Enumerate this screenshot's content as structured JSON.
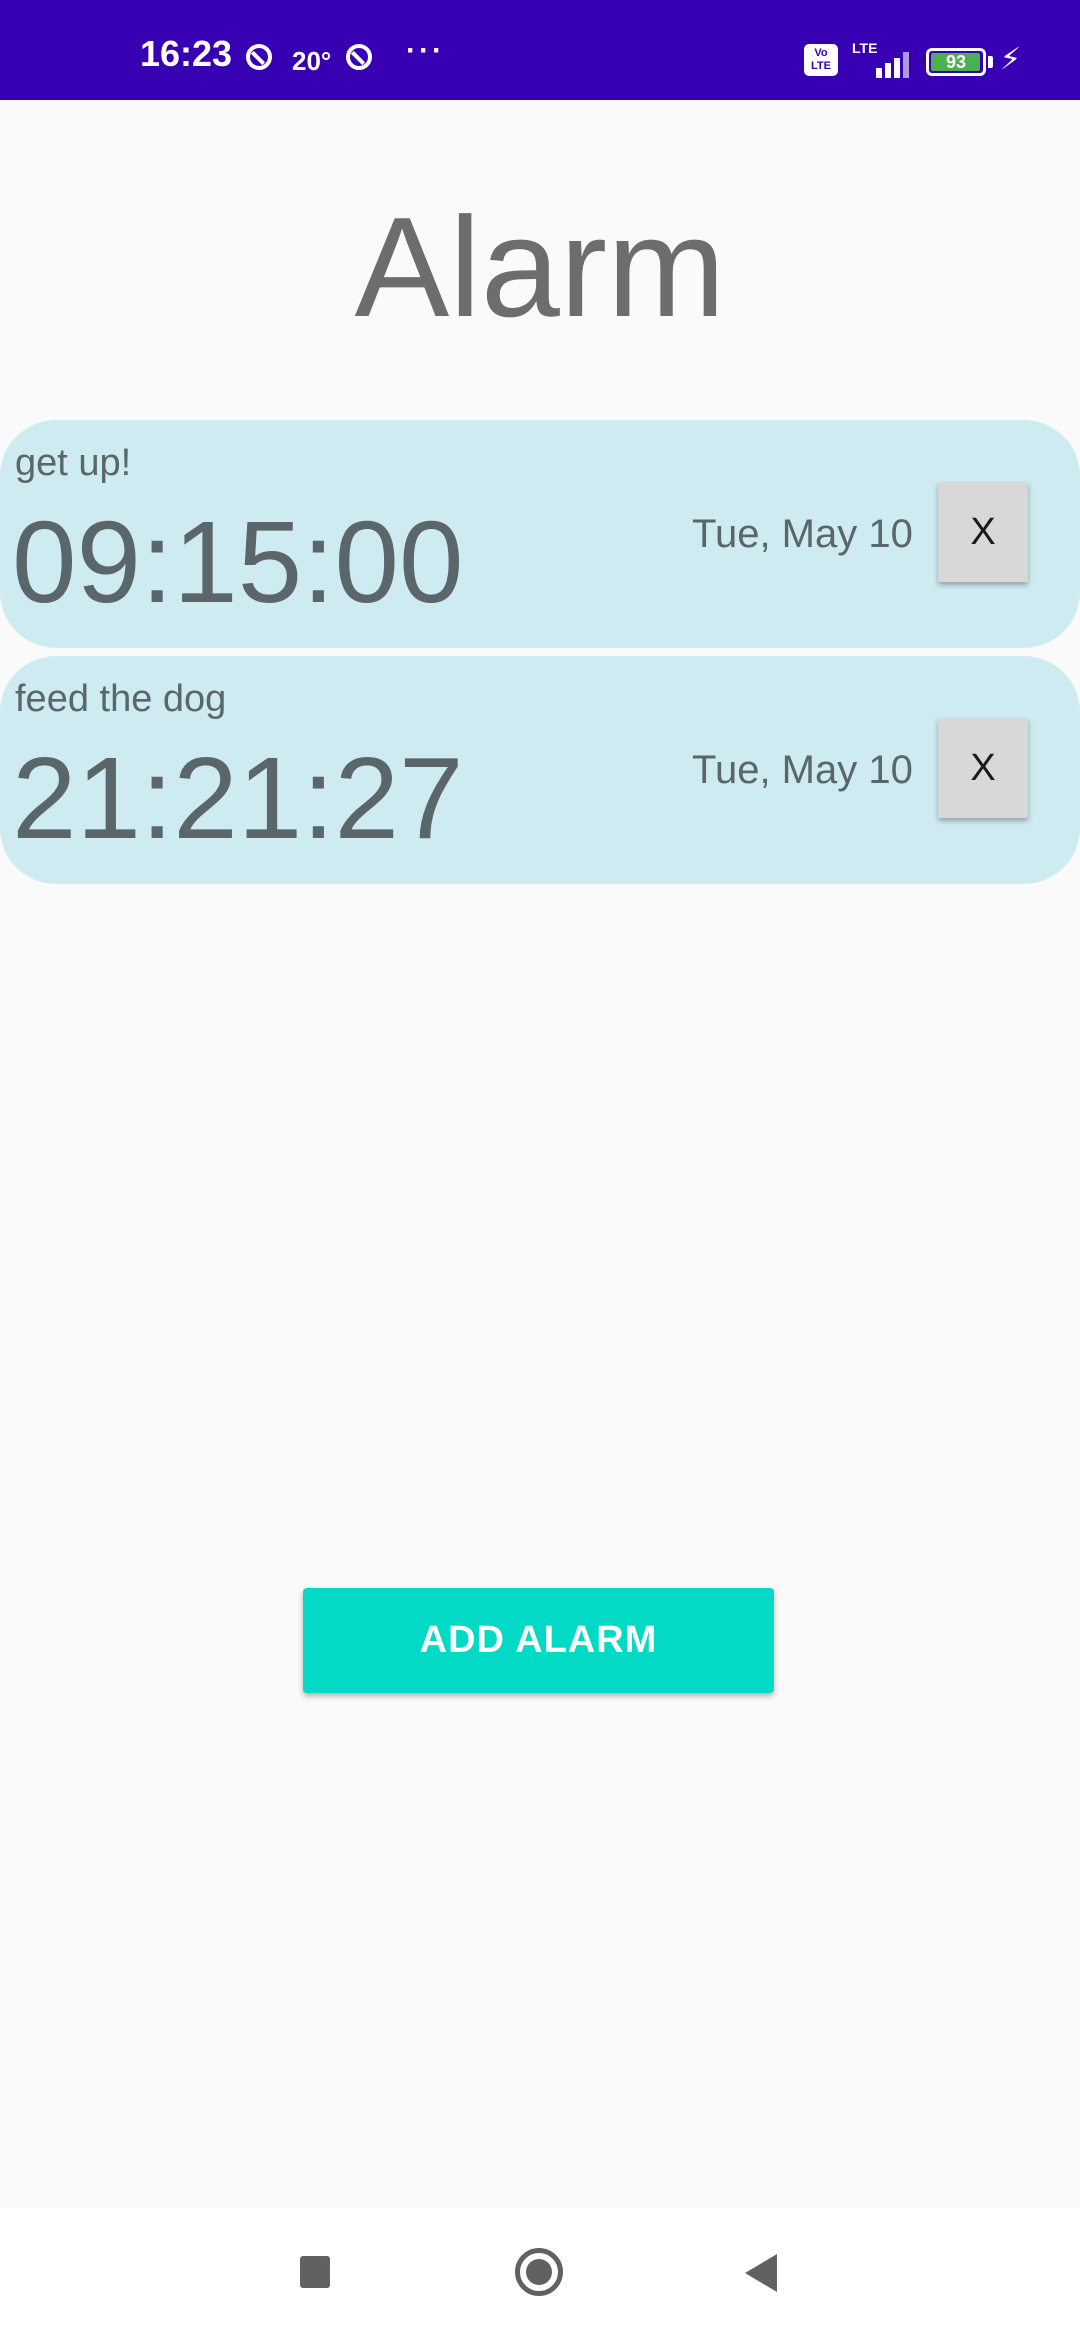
{
  "status_bar": {
    "time": "16:23",
    "temperature": "20°",
    "more": "···",
    "volte": "Vo LTE",
    "network": "LTE",
    "battery_level": "93",
    "charging": true,
    "background_color": "#3700b3"
  },
  "app": {
    "title": "Alarm"
  },
  "alarms": [
    {
      "label": "get up!",
      "time": "09:15:00",
      "date": "Tue, May 10",
      "delete_label": "X"
    },
    {
      "label": "feed the dog",
      "time": "21:21:27",
      "date": "Tue, May 10",
      "delete_label": "X"
    }
  ],
  "actions": {
    "add_alarm_label": "ADD ALARM",
    "accent_color": "#03dac5"
  },
  "colors": {
    "card_background": "#ceebf2",
    "page_background": "#fafafa"
  },
  "nav_bar": {
    "recents_icon": "square-recents-icon",
    "home_icon": "circle-home-icon",
    "back_icon": "triangle-back-icon"
  }
}
